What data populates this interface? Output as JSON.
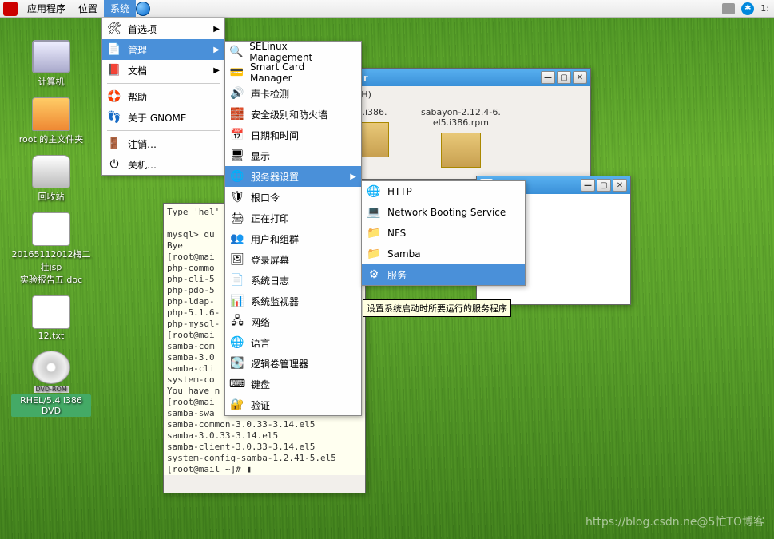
{
  "menubar": {
    "apps": "应用程序",
    "places": "位置",
    "system": "系统",
    "clock": "1:"
  },
  "system_menu": {
    "prefs": "首选项",
    "admin": "管理",
    "docs": "文档",
    "help": "帮助",
    "about": "关于 GNOME",
    "logout": "注销…",
    "shutdown": "关机…"
  },
  "admin_menu": {
    "selinux": "SELinux Management",
    "smartcard": "Smart Card Manager",
    "sound": "声卡检测",
    "security": "安全级别和防火墙",
    "datetime": "日期和时间",
    "display": "显示",
    "server": "服务器设置",
    "rootpw": "根口令",
    "printing": "正在打印",
    "usersgroups": "用户和组群",
    "loginscreen": "登录屏幕",
    "syslog": "系统日志",
    "sysmon": "系统监视器",
    "network": "网络",
    "language": "语言",
    "lvm": "逻辑卷管理器",
    "keyboard": "键盘",
    "auth": "验证"
  },
  "server_menu": {
    "http": "HTTP",
    "netboot": "Network Booting Service",
    "nfs": "NFS",
    "samba": "Samba",
    "services": "服务"
  },
  "desktop": {
    "computer": "计算机",
    "home": "root 的主文件夹",
    "trash": "回收站",
    "doc1_l1": "20165112012梅二壮jsp",
    "doc1_l2": "实验报告五.doc",
    "txt": "12.txt",
    "dvd_label": "DVD-ROM",
    "dvd": "RHEL/5.4 i386 DVD"
  },
  "files_window": {
    "menu_help": "助(H)",
    "file1": "26.i386.",
    "file2_l1": "sabayon-2.12.4-6.",
    "file2_l2": "el5.i386.rpm"
  },
  "terminal": {
    "content": "Type 'hel'\n\nmysql> qu\nBye\n[root@mai\nphp-commo\nphp-cli-5\nphp-pdo-5\nphp-ldap-\nphp-5.1.6-\nphp-mysql-\n[root@mai\nsamba-com\nsamba-3.0\nsamba-cli\nsystem-co\nYou have n             l/root\n[root@mai\nsamba-swa\nsamba-common-3.0.33-3.14.el5\nsamba-3.0.33-3.14.el5\nsamba-client-3.0.33-3.14.el5\nsystem-config-samba-1.2.41-5.el5\n[root@mail ~]# ▮"
  },
  "tooltip": "设置系统启动时所要运行的服务程序",
  "watermark": "https://blog.csdn.ne@5忙TO博客"
}
